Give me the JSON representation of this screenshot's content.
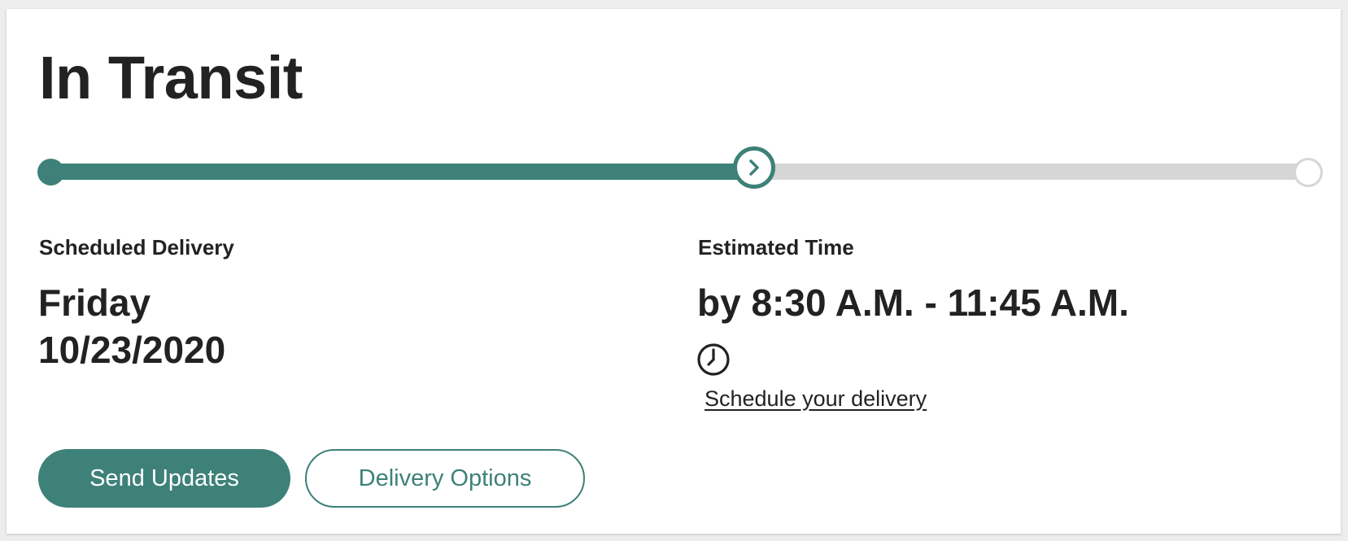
{
  "status": {
    "title": "In Transit"
  },
  "progress": {
    "value": 0.56,
    "active_color": "#3d8178",
    "inactive_color": "#d6d6d6",
    "current_node_icon": "chevron-right-icon"
  },
  "scheduled_delivery": {
    "label": "Scheduled Delivery",
    "day": "Friday",
    "date": "10/23/2020"
  },
  "estimated_time": {
    "label": "Estimated Time",
    "value": "by 8:30 A.M. - 11:45 A.M.",
    "icon": "clock-icon",
    "link_text": "Schedule your delivery"
  },
  "actions": {
    "send_updates": "Send Updates",
    "delivery_options": "Delivery Options"
  }
}
